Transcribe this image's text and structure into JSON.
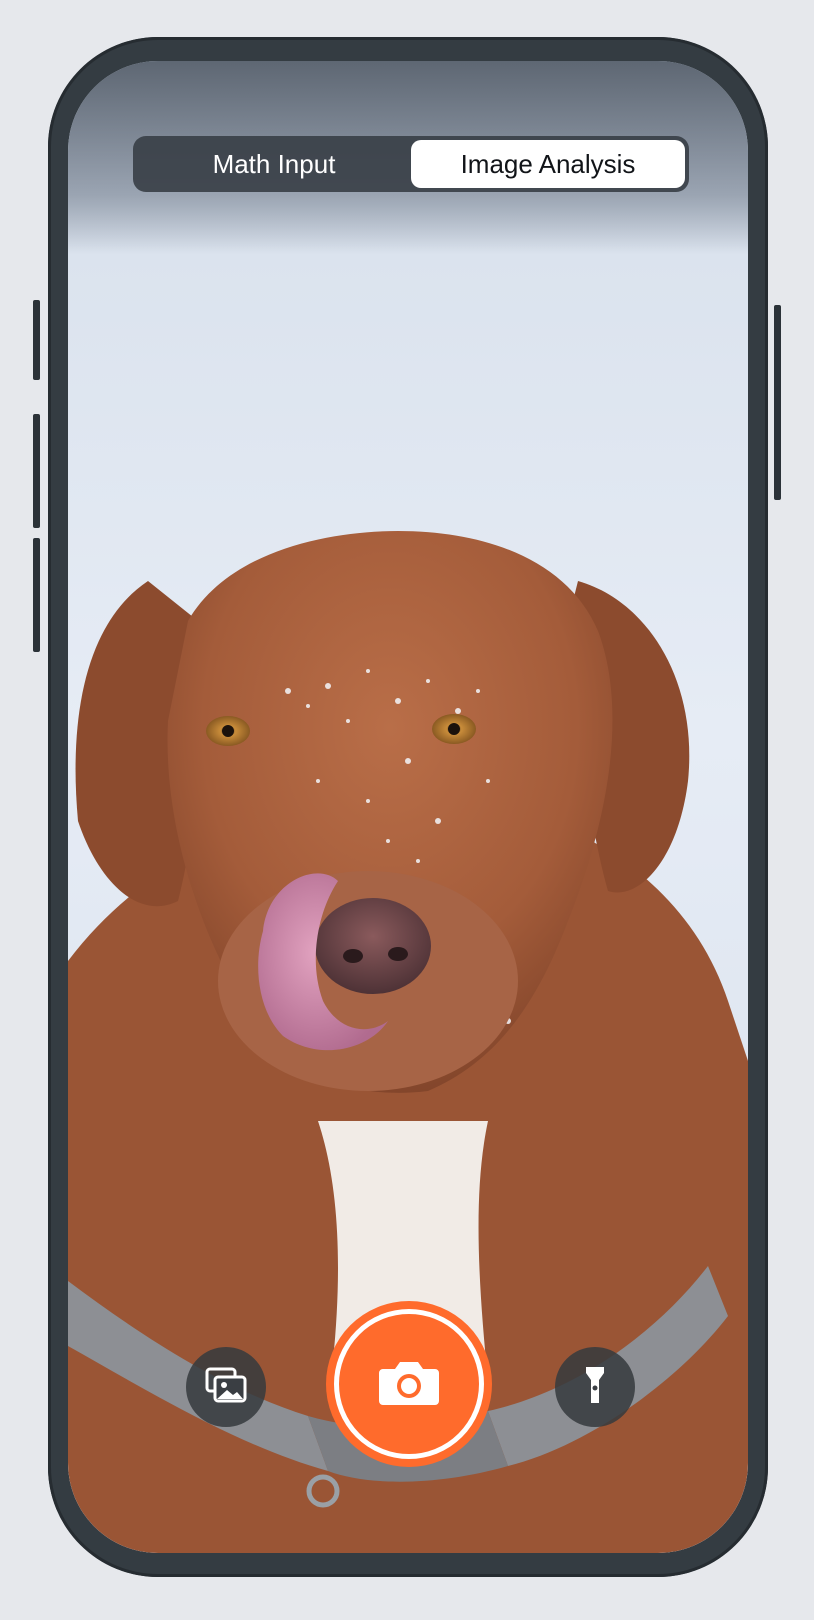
{
  "mode_switch": {
    "options": [
      "Math Input",
      "Image Analysis"
    ],
    "selected": "Image Analysis"
  },
  "camera": {
    "gallery_icon": "gallery-icon",
    "shutter_icon": "camera-icon",
    "torch_icon": "flashlight-icon"
  },
  "colors": {
    "accent": "#ff6b2c",
    "segment_bg": "#3a4048",
    "segment_active": "#ffffff"
  }
}
